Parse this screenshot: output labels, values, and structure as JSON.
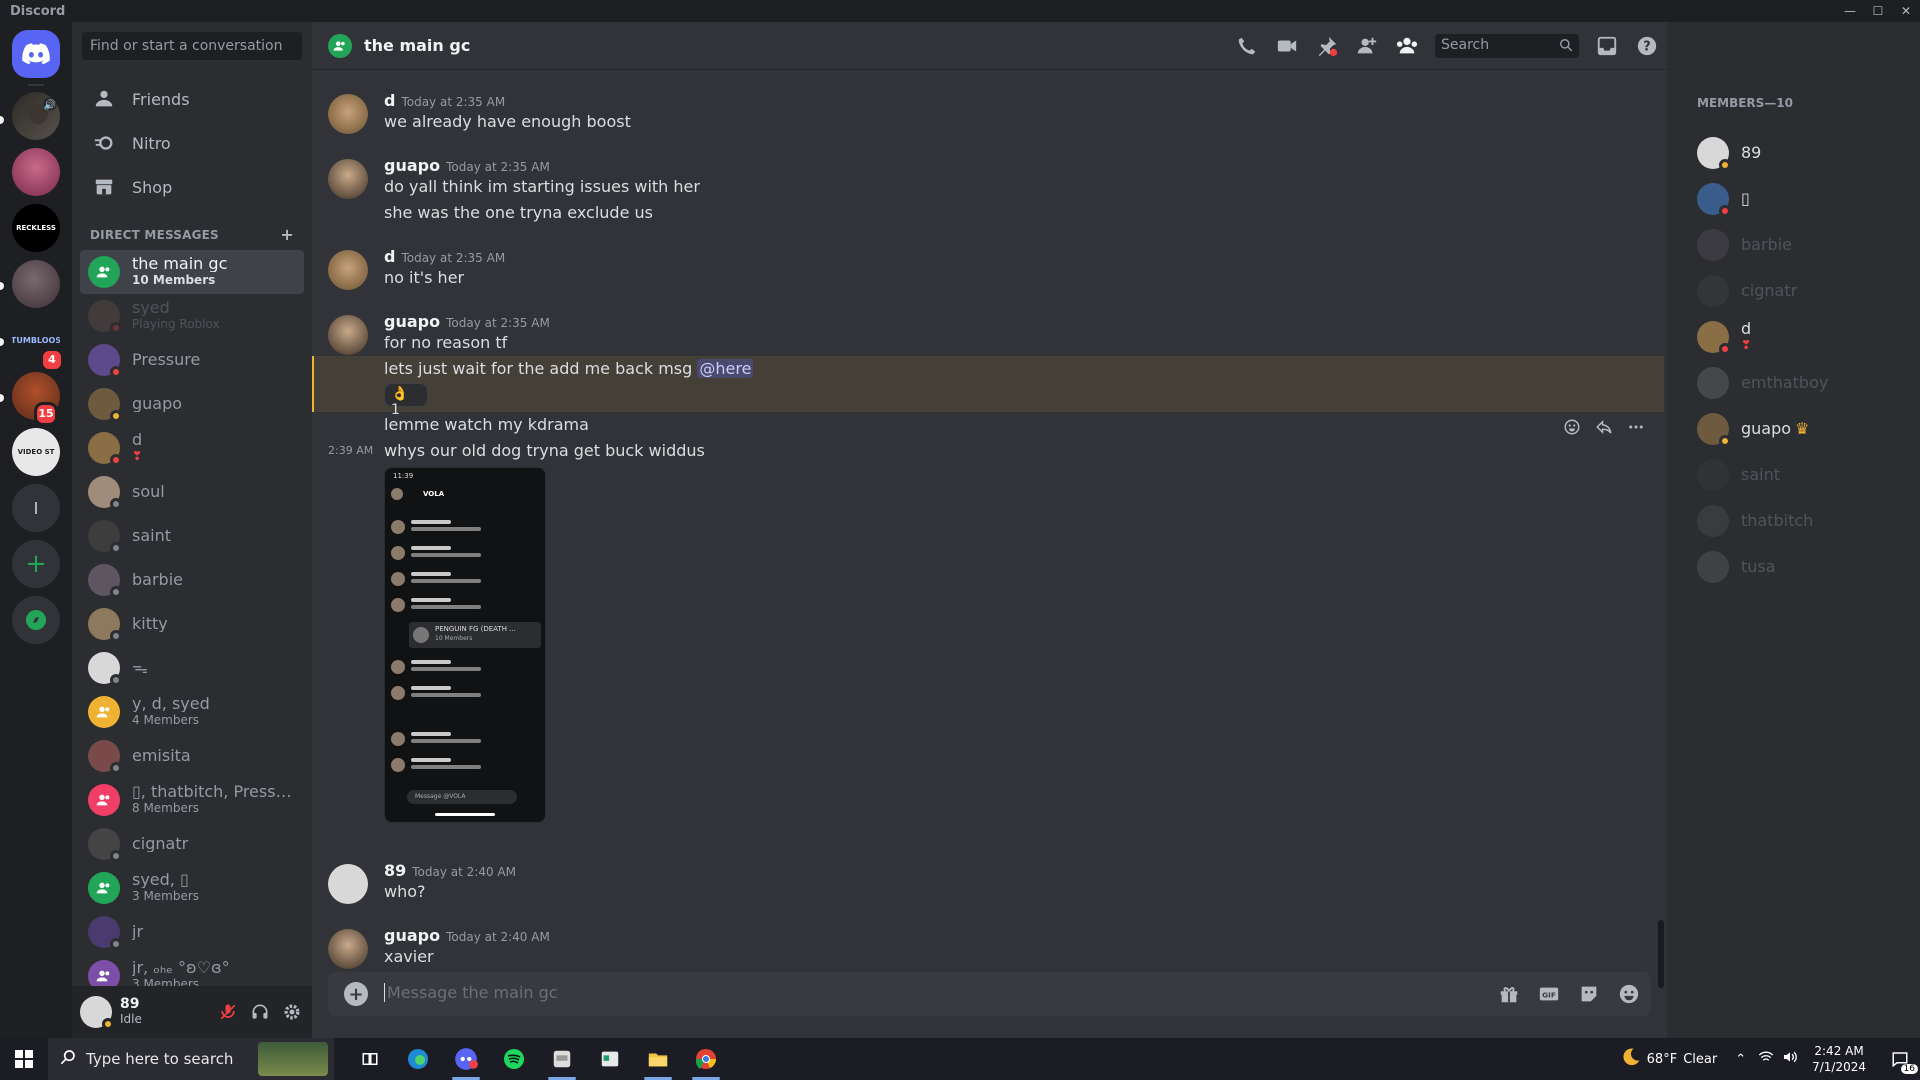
{
  "app": {
    "title": "Discord",
    "window_controls": [
      "—",
      "☐",
      "✕"
    ]
  },
  "servers": [
    {
      "name": "home",
      "badge": ""
    },
    {
      "name": "server-1",
      "badge": ""
    },
    {
      "name": "server-2",
      "badge": ""
    },
    {
      "name": "server-3",
      "label": "RECKLESS",
      "badge": ""
    },
    {
      "name": "server-4",
      "badge": ""
    },
    {
      "name": "server-5",
      "label": "TUMBLOOS",
      "badge": "4"
    },
    {
      "name": "server-6",
      "badge": "15"
    },
    {
      "name": "server-7",
      "label": "VIDEO ST",
      "badge": ""
    },
    {
      "name": "server-8",
      "label": "l",
      "badge": ""
    }
  ],
  "sidebar": {
    "search_placeholder": "Find or start a conversation",
    "nav": [
      {
        "label": "Friends"
      },
      {
        "label": "Nitro"
      },
      {
        "label": "Shop"
      }
    ],
    "dm_header": "DIRECT MESSAGES",
    "dms": [
      {
        "name": "the main gc",
        "sub": "10 Members",
        "color": "#23a559",
        "status": "",
        "group": true,
        "active": true
      },
      {
        "name": "syed",
        "sub": "Playing Roblox",
        "color": "#6b5a4e",
        "status": "#f23f43",
        "dim": true
      },
      {
        "name": "Pressure",
        "sub": "",
        "color": "#5c4a8a",
        "status": "#f23f43"
      },
      {
        "name": "guapo",
        "sub": "",
        "color": "#6e5a3e",
        "status": "#f0b232"
      },
      {
        "name": "d",
        "sub": "❣",
        "color": "#8a6e45",
        "status": "#f23f43"
      },
      {
        "name": "soul",
        "sub": "",
        "color": "#a08c7a",
        "status": "#80848e"
      },
      {
        "name": "saint",
        "sub": "",
        "color": "#3d3d3d",
        "status": "#80848e"
      },
      {
        "name": "barbie",
        "sub": "",
        "color": "#5e5560",
        "status": "#80848e"
      },
      {
        "name": "kitty",
        "sub": "",
        "color": "#8d7a5e",
        "status": "#80848e"
      },
      {
        "name": "ᯓ",
        "sub": "",
        "color": "#d8d8d8",
        "status": "#80848e"
      },
      {
        "name": "y, d, syed",
        "sub": "4 Members",
        "color": "#f0b232",
        "status": "",
        "group": true
      },
      {
        "name": "emisita",
        "sub": "",
        "color": "#7a4a4a",
        "status": "#80848e"
      },
      {
        "name": "▯, thatbitch, Pressure...",
        "sub": "8 Members",
        "color": "#f23f68",
        "status": "",
        "group": true
      },
      {
        "name": "cignatr",
        "sub": "",
        "color": "#444",
        "status": "#80848e"
      },
      {
        "name": "syed, ▯",
        "sub": "3 Members",
        "color": "#23a559",
        "status": "",
        "group": true
      },
      {
        "name": "jr",
        "sub": "",
        "color": "#4a3b6e",
        "status": "#80848e"
      },
      {
        "name": "jr, ₒₕₑ °ʚ♡ɞ°",
        "sub": "3 Members",
        "color": "#7b4fa8",
        "status": "",
        "group": true
      }
    ]
  },
  "user": {
    "name": "89",
    "status": "Idle"
  },
  "channel": {
    "title": "the main gc",
    "search_placeholder": "Search"
  },
  "messages": [
    {
      "author": "d",
      "time": "Today at 2:35 AM",
      "lines": [
        "we already have enough boost"
      ]
    },
    {
      "author": "guapo",
      "time": "Today at 2:35 AM",
      "lines": [
        "do yall think im starting issues with her",
        "she was the one tryna exclude us"
      ]
    },
    {
      "author": "d",
      "time": "Today at 2:35 AM",
      "lines": [
        "no it's her"
      ]
    },
    {
      "author": "guapo",
      "time": "Today at 2:35 AM",
      "lines": [
        "for no reason tf"
      ]
    },
    {
      "highlight_text": "lets just wait for the add me back msg ",
      "mention": "@here",
      "reaction_emoji": "👌",
      "reaction_count": "1"
    },
    {
      "lines": [
        "lemme watch my kdrama"
      ]
    },
    {
      "side_time": "2:39 AM",
      "lines": [
        "whys our old dog tryna get buck widdus"
      ]
    },
    {
      "author": "89",
      "time": "Today at 2:40 AM",
      "lines": [
        "who?"
      ]
    },
    {
      "author": "guapo",
      "time": "Today at 2:40 AM",
      "lines": [
        "xavier"
      ]
    }
  ],
  "attachment": {
    "status_time": "11:39",
    "title": "VOLA",
    "card_title": "PENGUIN FG (DEATH ...",
    "card_sub": "10 Members",
    "composer_placeholder": "Message @VOLA"
  },
  "composer": {
    "placeholder": "Message the main gc"
  },
  "members": {
    "header": "MEMBERS—10",
    "list": [
      {
        "name": "89",
        "color": "#d8d8d8",
        "status": "#f0b232",
        "online": true
      },
      {
        "name": "▯",
        "color": "#3a5c8a",
        "status": "#f23f43",
        "online": true
      },
      {
        "name": "barbie",
        "color": "#5e5560",
        "status": "#80848e",
        "online": false
      },
      {
        "name": "cignatr",
        "color": "#444",
        "status": "#80848e",
        "online": false
      },
      {
        "name": "d",
        "sub": "❣",
        "color": "#8a6e45",
        "status": "#f23f43",
        "online": true
      },
      {
        "name": "emthatboy",
        "color": "#777",
        "status": "#80848e",
        "online": false
      },
      {
        "name": "guapo",
        "crown": "♛",
        "color": "#6e5a3e",
        "status": "#f0b232",
        "online": true
      },
      {
        "name": "saint",
        "color": "#3d3d3d",
        "status": "#80848e",
        "online": false
      },
      {
        "name": "thatbitch",
        "color": "#555",
        "status": "#80848e",
        "online": false
      },
      {
        "name": "tusa",
        "color": "#666",
        "status": "#80848e",
        "online": false
      }
    ]
  },
  "taskbar": {
    "search_placeholder": "Type here to search",
    "weather_temp": "68°F",
    "weather_desc": "Clear",
    "time": "2:42 AM",
    "date": "7/1/2024",
    "notif_count": "16"
  }
}
